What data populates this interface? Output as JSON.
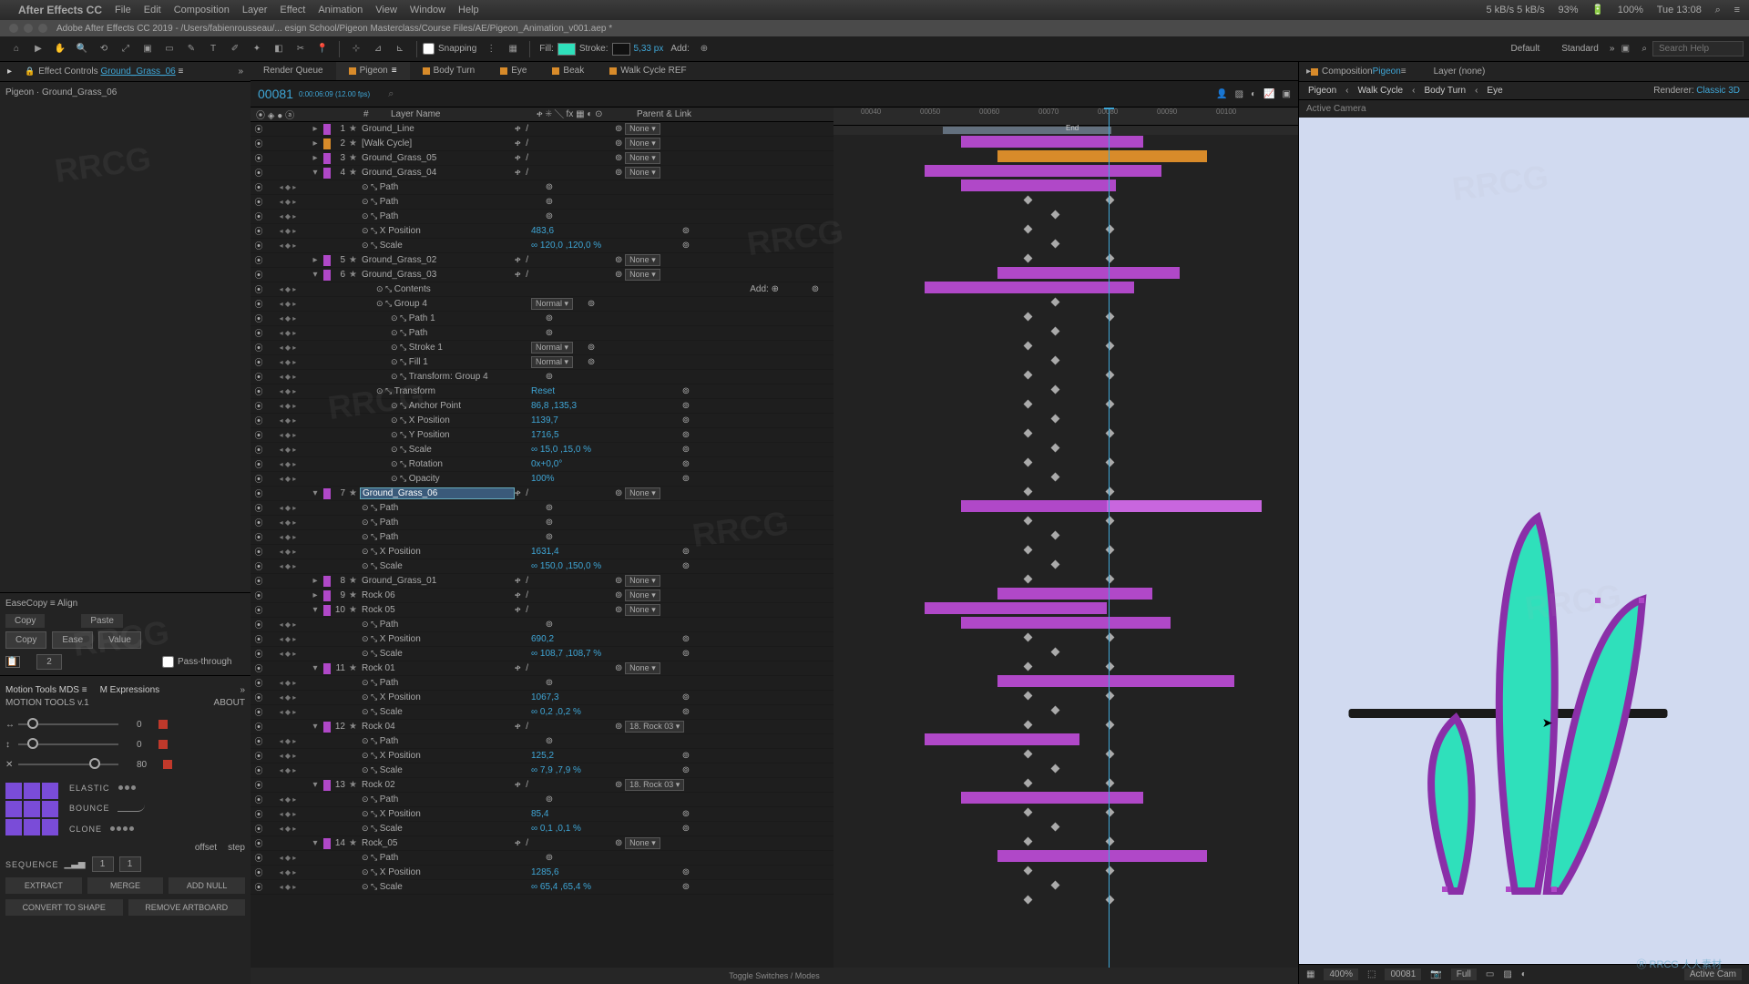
{
  "mac": {
    "app": "After Effects CC",
    "menus": [
      "File",
      "Edit",
      "Composition",
      "Layer",
      "Effect",
      "Animation",
      "View",
      "Window",
      "Help"
    ],
    "right": [
      "93%",
      "100%",
      "Tue 13:08"
    ],
    "net": "5 kB/s  5 kB/s"
  },
  "doc_title": "Adobe After Effects CC 2019 - /Users/fabienrousseau/... esign School/Pigeon Masterclass/Course Files/AE/Pigeon_Animation_v001.aep *",
  "toolbar": {
    "snapping": "Snapping",
    "fill": "Fill:",
    "stroke": "Stroke:",
    "stroke_px": "5,33 px",
    "add": "Add:",
    "workspaces": [
      "Default",
      "Standard"
    ],
    "search_ph": "Search Help"
  },
  "effect_panel": {
    "tab_label": "Effect Controls",
    "tab_layer": "Ground_Grass_06",
    "breadcrumb": "Pigeon · Ground_Grass_06"
  },
  "easecopy": {
    "title": "EaseCopy  ≡      Align",
    "copy": "Copy",
    "paste": "Paste",
    "btn_copy": "Copy",
    "btn_ease": "Ease",
    "btn_value": "Value",
    "num": "2",
    "pass": "Pass-through"
  },
  "motion": {
    "tab1": "Motion Tools MDS  ≡",
    "tab2": "M Expressions",
    "brand": "MOTION TOOLS v.1",
    "about": "ABOUT",
    "s1": "0",
    "s2": "0",
    "s3": "80",
    "elastic": "ELASTIC",
    "bounce": "BOUNCE",
    "clone": "CLONE",
    "offset": "offset",
    "step": "step",
    "i1": "1",
    "i2": "1",
    "sequence": "SEQUENCE",
    "extract": "EXTRACT",
    "merge": "MERGE",
    "addnull": "ADD NULL",
    "convert": "CONVERT TO SHAPE",
    "remove": "REMOVE ARTBOARD"
  },
  "comp_tabs": {
    "rq": "Render Queue",
    "tabs": [
      "Pigeon",
      "Body Turn",
      "Eye",
      "Beak",
      "Walk Cycle REF"
    ],
    "active": 0
  },
  "tl_header": {
    "time": "00081",
    "fps": "0:00:06:09 (12.00 fps)",
    "search": "⌕"
  },
  "columns": {
    "c1": "⦿ ◈ ● ⓐ",
    "idx": "#",
    "name": "Layer Name",
    "mode": "ቀ ✳ ╲ fx ▦ ◐ ⊙",
    "parent": "Parent & Link"
  },
  "ruler": {
    "ticks": [
      "00040",
      "00050",
      "00060",
      "00070",
      "00080",
      "00090",
      "00100"
    ],
    "end": "End"
  },
  "parent_none": "None",
  "layers": [
    {
      "type": "layer",
      "idx": "1",
      "name": "Ground_Line",
      "lbl": "purple",
      "parent": "None"
    },
    {
      "type": "layer",
      "idx": "2",
      "name": "[Walk Cycle]",
      "lbl": "orange",
      "parent": "None"
    },
    {
      "type": "layer",
      "idx": "3",
      "name": "Ground_Grass_05",
      "lbl": "purple",
      "parent": "None"
    },
    {
      "type": "layer",
      "idx": "4",
      "name": "Ground_Grass_04",
      "lbl": "purple",
      "parent": "None",
      "open": true
    },
    {
      "type": "prop",
      "name": "Path"
    },
    {
      "type": "prop",
      "name": "Path"
    },
    {
      "type": "prop",
      "name": "Path"
    },
    {
      "type": "prop",
      "name": "X Position",
      "val": "483,6"
    },
    {
      "type": "prop",
      "name": "Scale",
      "val": "∞ 120,0 ,120,0 %"
    },
    {
      "type": "layer",
      "idx": "5",
      "name": "Ground_Grass_02",
      "lbl": "purple",
      "parent": "None"
    },
    {
      "type": "layer",
      "idx": "6",
      "name": "Ground_Grass_03",
      "lbl": "purple",
      "parent": "None",
      "open": true
    },
    {
      "type": "prop2",
      "name": "Contents",
      "add": "Add: ⊕"
    },
    {
      "type": "prop2",
      "name": "Group 4",
      "dd": "Normal"
    },
    {
      "type": "prop3",
      "name": "Path 1"
    },
    {
      "type": "prop3i",
      "name": "Path"
    },
    {
      "type": "prop3",
      "name": "Stroke 1",
      "dd": "Normal"
    },
    {
      "type": "prop3",
      "name": "Fill 1",
      "dd": "Normal"
    },
    {
      "type": "prop3",
      "name": "Transform: Group 4"
    },
    {
      "type": "prop2",
      "name": "Transform",
      "val": "Reset"
    },
    {
      "type": "prop3",
      "name": "Anchor Point",
      "val": "86,8 ,135,3"
    },
    {
      "type": "prop3",
      "name": "X Position",
      "val": "1139,7"
    },
    {
      "type": "prop3",
      "name": "Y Position",
      "val": "1716,5"
    },
    {
      "type": "prop3",
      "name": "Scale",
      "val": "∞ 15,0 ,15,0 %"
    },
    {
      "type": "prop3",
      "name": "Rotation",
      "val": "0x+0,0°"
    },
    {
      "type": "prop3",
      "name": "Opacity",
      "val": "100%"
    },
    {
      "type": "layer",
      "idx": "7",
      "name": "Ground_Grass_06",
      "lbl": "purple",
      "parent": "None",
      "sel": true,
      "open": true
    },
    {
      "type": "prop",
      "name": "Path"
    },
    {
      "type": "prop",
      "name": "Path"
    },
    {
      "type": "prop",
      "name": "Path"
    },
    {
      "type": "prop",
      "name": "X Position",
      "val": "1631,4"
    },
    {
      "type": "prop",
      "name": "Scale",
      "val": "∞ 150,0 ,150,0 %"
    },
    {
      "type": "layer",
      "idx": "8",
      "name": "Ground_Grass_01",
      "lbl": "purple",
      "parent": "None"
    },
    {
      "type": "layer",
      "idx": "9",
      "name": "Rock 06",
      "lbl": "purple",
      "parent": "None"
    },
    {
      "type": "layer",
      "idx": "10",
      "name": "Rock 05",
      "lbl": "purple",
      "parent": "None",
      "open": true
    },
    {
      "type": "prop",
      "name": "Path"
    },
    {
      "type": "prop",
      "name": "X Position",
      "val": "690,2"
    },
    {
      "type": "prop",
      "name": "Scale",
      "val": "∞ 108,7 ,108,7 %"
    },
    {
      "type": "layer",
      "idx": "11",
      "name": "Rock 01",
      "lbl": "purple",
      "parent": "None",
      "open": true
    },
    {
      "type": "prop",
      "name": "Path"
    },
    {
      "type": "prop",
      "name": "X Position",
      "val": "1067,3"
    },
    {
      "type": "prop",
      "name": "Scale",
      "val": "∞ 0,2 ,0,2 %"
    },
    {
      "type": "layer",
      "idx": "12",
      "name": "Rock 04",
      "lbl": "purple",
      "parent": "18. Rock 03",
      "open": true
    },
    {
      "type": "prop",
      "name": "Path"
    },
    {
      "type": "prop",
      "name": "X Position",
      "val": "125,2"
    },
    {
      "type": "prop",
      "name": "Scale",
      "val": "∞ 7,9 ,7,9 %"
    },
    {
      "type": "layer",
      "idx": "13",
      "name": "Rock 02",
      "lbl": "purple",
      "parent": "18. Rock 03",
      "open": true
    },
    {
      "type": "prop",
      "name": "Path"
    },
    {
      "type": "prop",
      "name": "X Position",
      "val": "85,4"
    },
    {
      "type": "prop",
      "name": "Scale",
      "val": "∞ 0,1 ,0,1 %"
    },
    {
      "type": "layer",
      "idx": "14",
      "name": "Rock_05",
      "lbl": "purple",
      "parent": "None",
      "open": true
    },
    {
      "type": "prop",
      "name": "Path"
    },
    {
      "type": "prop",
      "name": "X Position",
      "val": "1285,6"
    },
    {
      "type": "prop",
      "name": "Scale",
      "val": "∞ 65,4 ,65,4 %"
    }
  ],
  "tl_footer": "Toggle Switches / Modes",
  "comp_panel": {
    "tab_prefix": "Composition",
    "tab_name": "Pigeon",
    "layer_none": "Layer (none)",
    "crumbs": [
      "Pigeon",
      "Walk Cycle",
      "Body Turn",
      "Eye"
    ],
    "renderer": "Renderer:",
    "renderer_v": "Classic 3D",
    "active_cam": "Active Camera"
  },
  "viewer_footer": {
    "zoom": "400%",
    "frame": "00081",
    "res": "Full",
    "cam": "Active Cam"
  }
}
